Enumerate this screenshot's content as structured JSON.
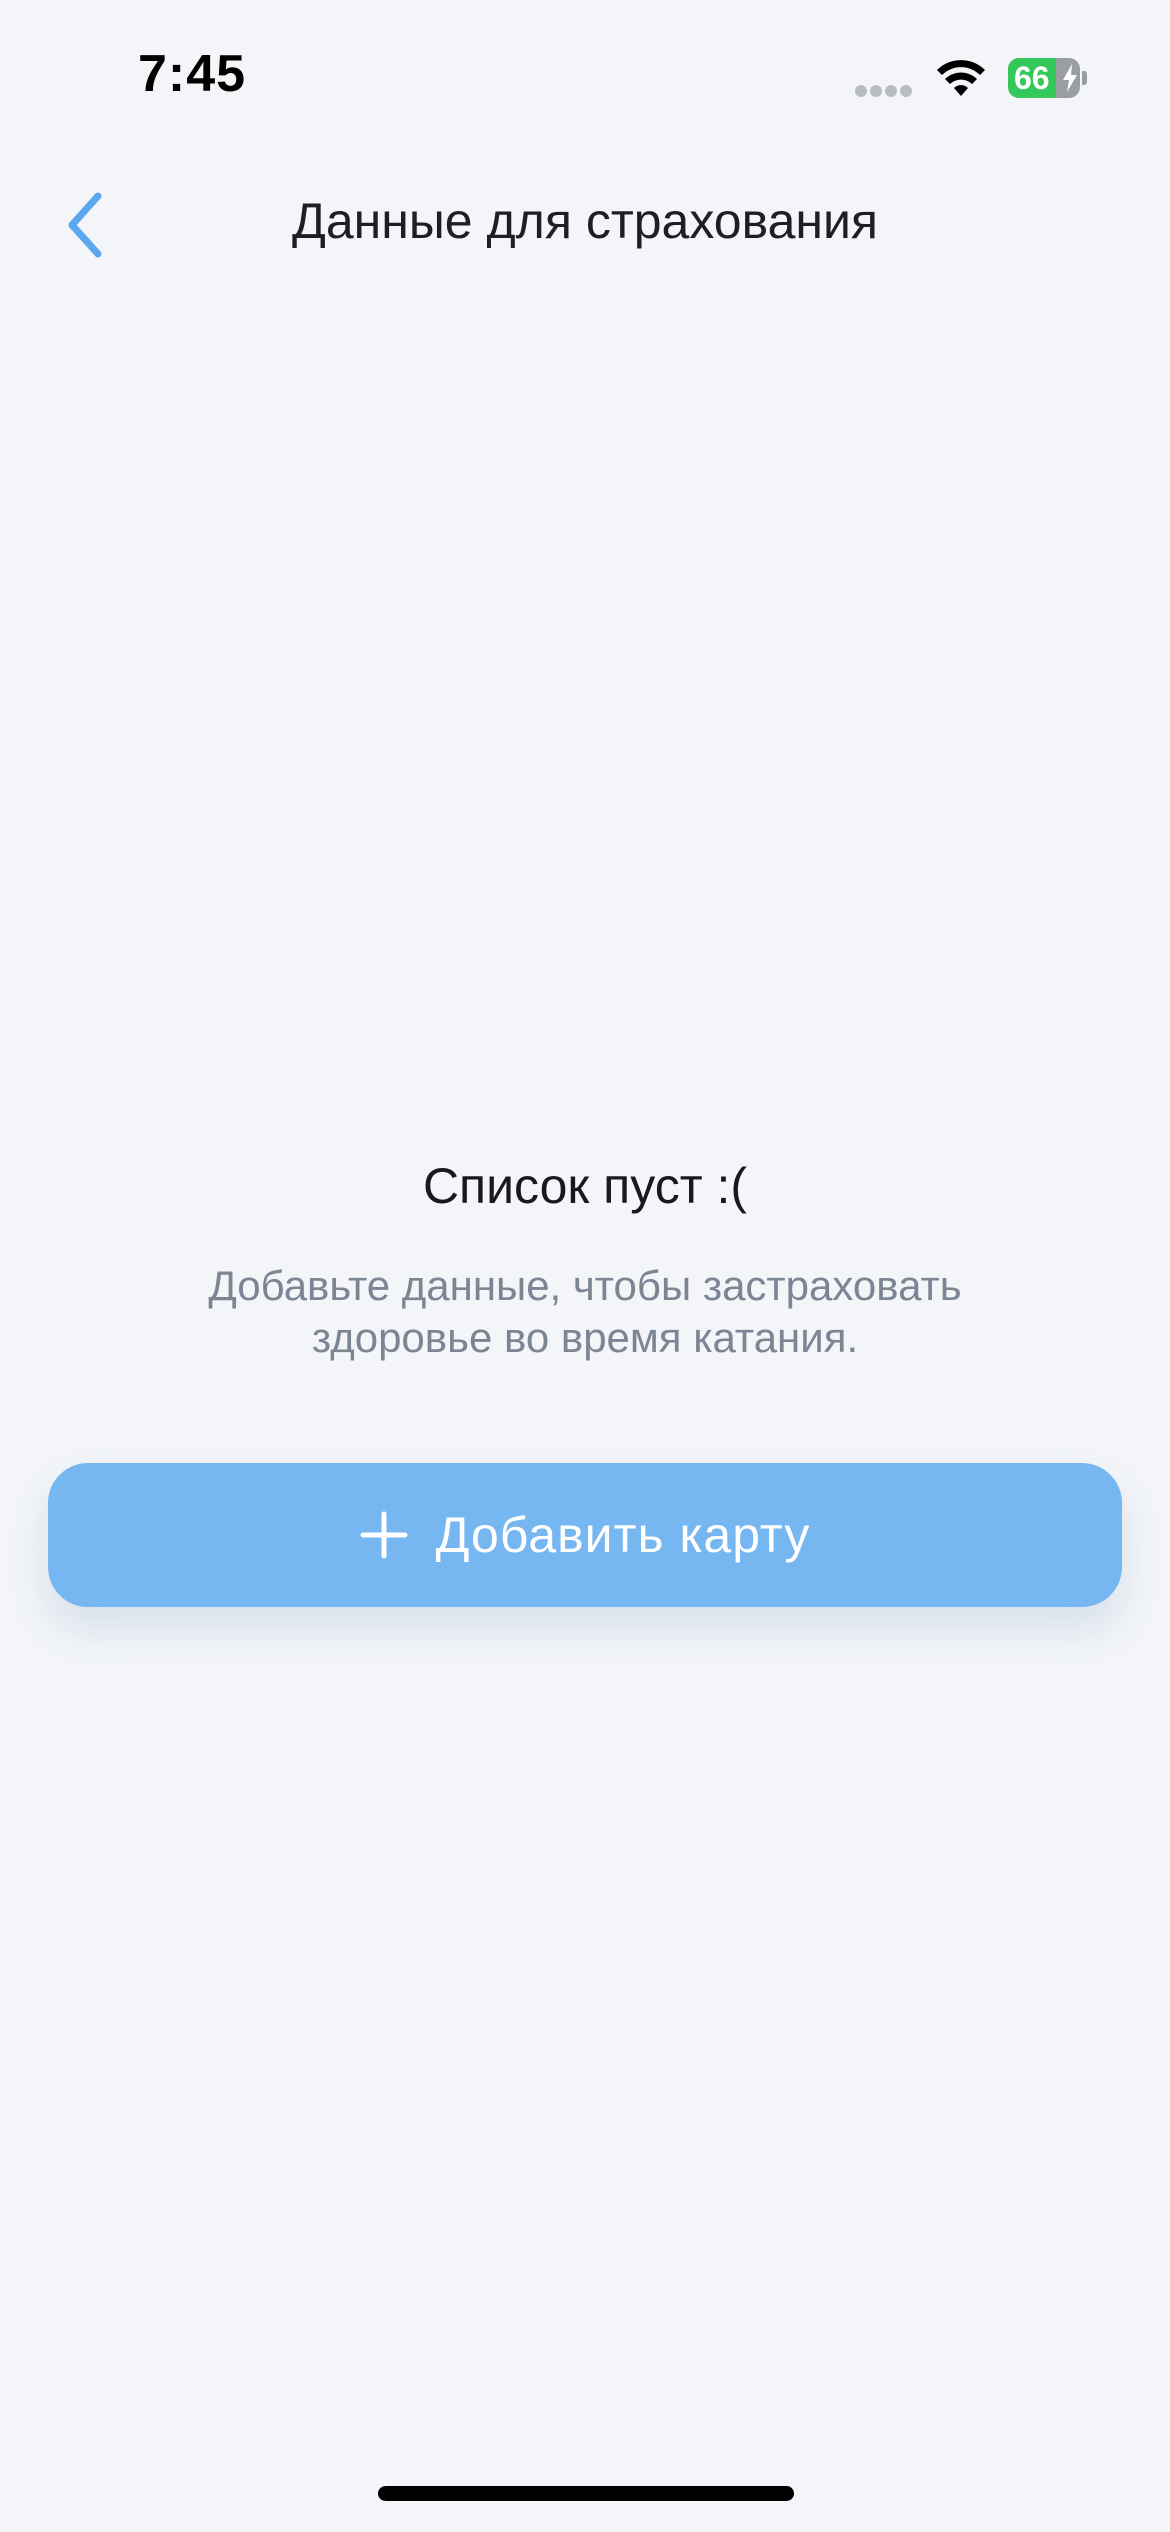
{
  "status_bar": {
    "time": "7:45",
    "battery_level": "66",
    "battery_fraction": 0.66,
    "signal_icon": "cellular-signal-icon",
    "wifi_icon": "wifi-icon",
    "battery_icon": "battery-charging-icon"
  },
  "nav": {
    "back_icon": "chevron-left-icon",
    "title": "Данные для страхования"
  },
  "empty_state": {
    "title": "Список пуст :(",
    "description": "Добавьте данные, чтобы застраховать здоровье во время катания."
  },
  "add_button": {
    "icon": "plus-icon",
    "label": "Добавить карту"
  },
  "colors": {
    "background": "#f3f5f8",
    "accent": "#76b6f1",
    "back_chevron": "#5aa8ef",
    "battery_green": "#34c759"
  }
}
